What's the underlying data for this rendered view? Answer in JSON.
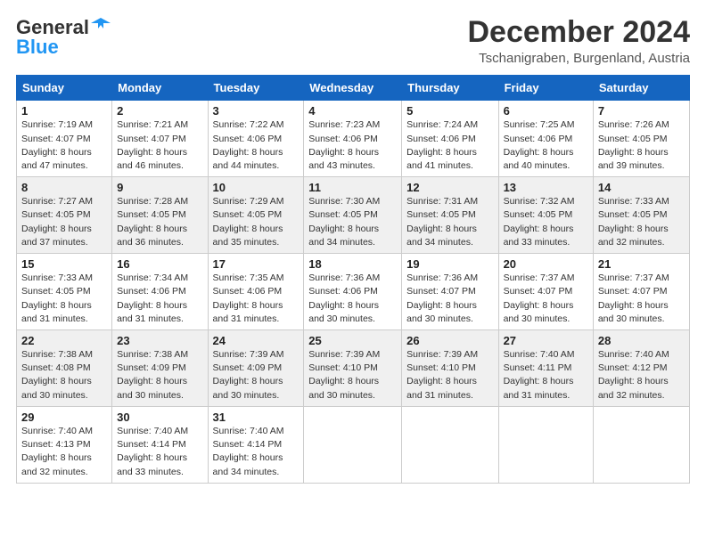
{
  "logo": {
    "line1": "General",
    "line2": "Blue"
  },
  "title": "December 2024",
  "location": "Tschanigraben, Burgenland, Austria",
  "days_of_week": [
    "Sunday",
    "Monday",
    "Tuesday",
    "Wednesday",
    "Thursday",
    "Friday",
    "Saturday"
  ],
  "weeks": [
    [
      {
        "day": 1,
        "sunrise": "7:19 AM",
        "sunset": "4:07 PM",
        "daylight": "8 hours and 47 minutes."
      },
      {
        "day": 2,
        "sunrise": "7:21 AM",
        "sunset": "4:07 PM",
        "daylight": "8 hours and 46 minutes."
      },
      {
        "day": 3,
        "sunrise": "7:22 AM",
        "sunset": "4:06 PM",
        "daylight": "8 hours and 44 minutes."
      },
      {
        "day": 4,
        "sunrise": "7:23 AM",
        "sunset": "4:06 PM",
        "daylight": "8 hours and 43 minutes."
      },
      {
        "day": 5,
        "sunrise": "7:24 AM",
        "sunset": "4:06 PM",
        "daylight": "8 hours and 41 minutes."
      },
      {
        "day": 6,
        "sunrise": "7:25 AM",
        "sunset": "4:06 PM",
        "daylight": "8 hours and 40 minutes."
      },
      {
        "day": 7,
        "sunrise": "7:26 AM",
        "sunset": "4:05 PM",
        "daylight": "8 hours and 39 minutes."
      }
    ],
    [
      {
        "day": 8,
        "sunrise": "7:27 AM",
        "sunset": "4:05 PM",
        "daylight": "8 hours and 37 minutes."
      },
      {
        "day": 9,
        "sunrise": "7:28 AM",
        "sunset": "4:05 PM",
        "daylight": "8 hours and 36 minutes."
      },
      {
        "day": 10,
        "sunrise": "7:29 AM",
        "sunset": "4:05 PM",
        "daylight": "8 hours and 35 minutes."
      },
      {
        "day": 11,
        "sunrise": "7:30 AM",
        "sunset": "4:05 PM",
        "daylight": "8 hours and 34 minutes."
      },
      {
        "day": 12,
        "sunrise": "7:31 AM",
        "sunset": "4:05 PM",
        "daylight": "8 hours and 34 minutes."
      },
      {
        "day": 13,
        "sunrise": "7:32 AM",
        "sunset": "4:05 PM",
        "daylight": "8 hours and 33 minutes."
      },
      {
        "day": 14,
        "sunrise": "7:33 AM",
        "sunset": "4:05 PM",
        "daylight": "8 hours and 32 minutes."
      }
    ],
    [
      {
        "day": 15,
        "sunrise": "7:33 AM",
        "sunset": "4:05 PM",
        "daylight": "8 hours and 31 minutes."
      },
      {
        "day": 16,
        "sunrise": "7:34 AM",
        "sunset": "4:06 PM",
        "daylight": "8 hours and 31 minutes."
      },
      {
        "day": 17,
        "sunrise": "7:35 AM",
        "sunset": "4:06 PM",
        "daylight": "8 hours and 31 minutes."
      },
      {
        "day": 18,
        "sunrise": "7:36 AM",
        "sunset": "4:06 PM",
        "daylight": "8 hours and 30 minutes."
      },
      {
        "day": 19,
        "sunrise": "7:36 AM",
        "sunset": "4:07 PM",
        "daylight": "8 hours and 30 minutes."
      },
      {
        "day": 20,
        "sunrise": "7:37 AM",
        "sunset": "4:07 PM",
        "daylight": "8 hours and 30 minutes."
      },
      {
        "day": 21,
        "sunrise": "7:37 AM",
        "sunset": "4:07 PM",
        "daylight": "8 hours and 30 minutes."
      }
    ],
    [
      {
        "day": 22,
        "sunrise": "7:38 AM",
        "sunset": "4:08 PM",
        "daylight": "8 hours and 30 minutes."
      },
      {
        "day": 23,
        "sunrise": "7:38 AM",
        "sunset": "4:09 PM",
        "daylight": "8 hours and 30 minutes."
      },
      {
        "day": 24,
        "sunrise": "7:39 AM",
        "sunset": "4:09 PM",
        "daylight": "8 hours and 30 minutes."
      },
      {
        "day": 25,
        "sunrise": "7:39 AM",
        "sunset": "4:10 PM",
        "daylight": "8 hours and 30 minutes."
      },
      {
        "day": 26,
        "sunrise": "7:39 AM",
        "sunset": "4:10 PM",
        "daylight": "8 hours and 31 minutes."
      },
      {
        "day": 27,
        "sunrise": "7:40 AM",
        "sunset": "4:11 PM",
        "daylight": "8 hours and 31 minutes."
      },
      {
        "day": 28,
        "sunrise": "7:40 AM",
        "sunset": "4:12 PM",
        "daylight": "8 hours and 32 minutes."
      }
    ],
    [
      {
        "day": 29,
        "sunrise": "7:40 AM",
        "sunset": "4:13 PM",
        "daylight": "8 hours and 32 minutes."
      },
      {
        "day": 30,
        "sunrise": "7:40 AM",
        "sunset": "4:14 PM",
        "daylight": "8 hours and 33 minutes."
      },
      {
        "day": 31,
        "sunrise": "7:40 AM",
        "sunset": "4:14 PM",
        "daylight": "8 hours and 34 minutes."
      },
      null,
      null,
      null,
      null
    ]
  ],
  "labels": {
    "sunrise": "Sunrise:",
    "sunset": "Sunset:",
    "daylight": "Daylight:"
  }
}
